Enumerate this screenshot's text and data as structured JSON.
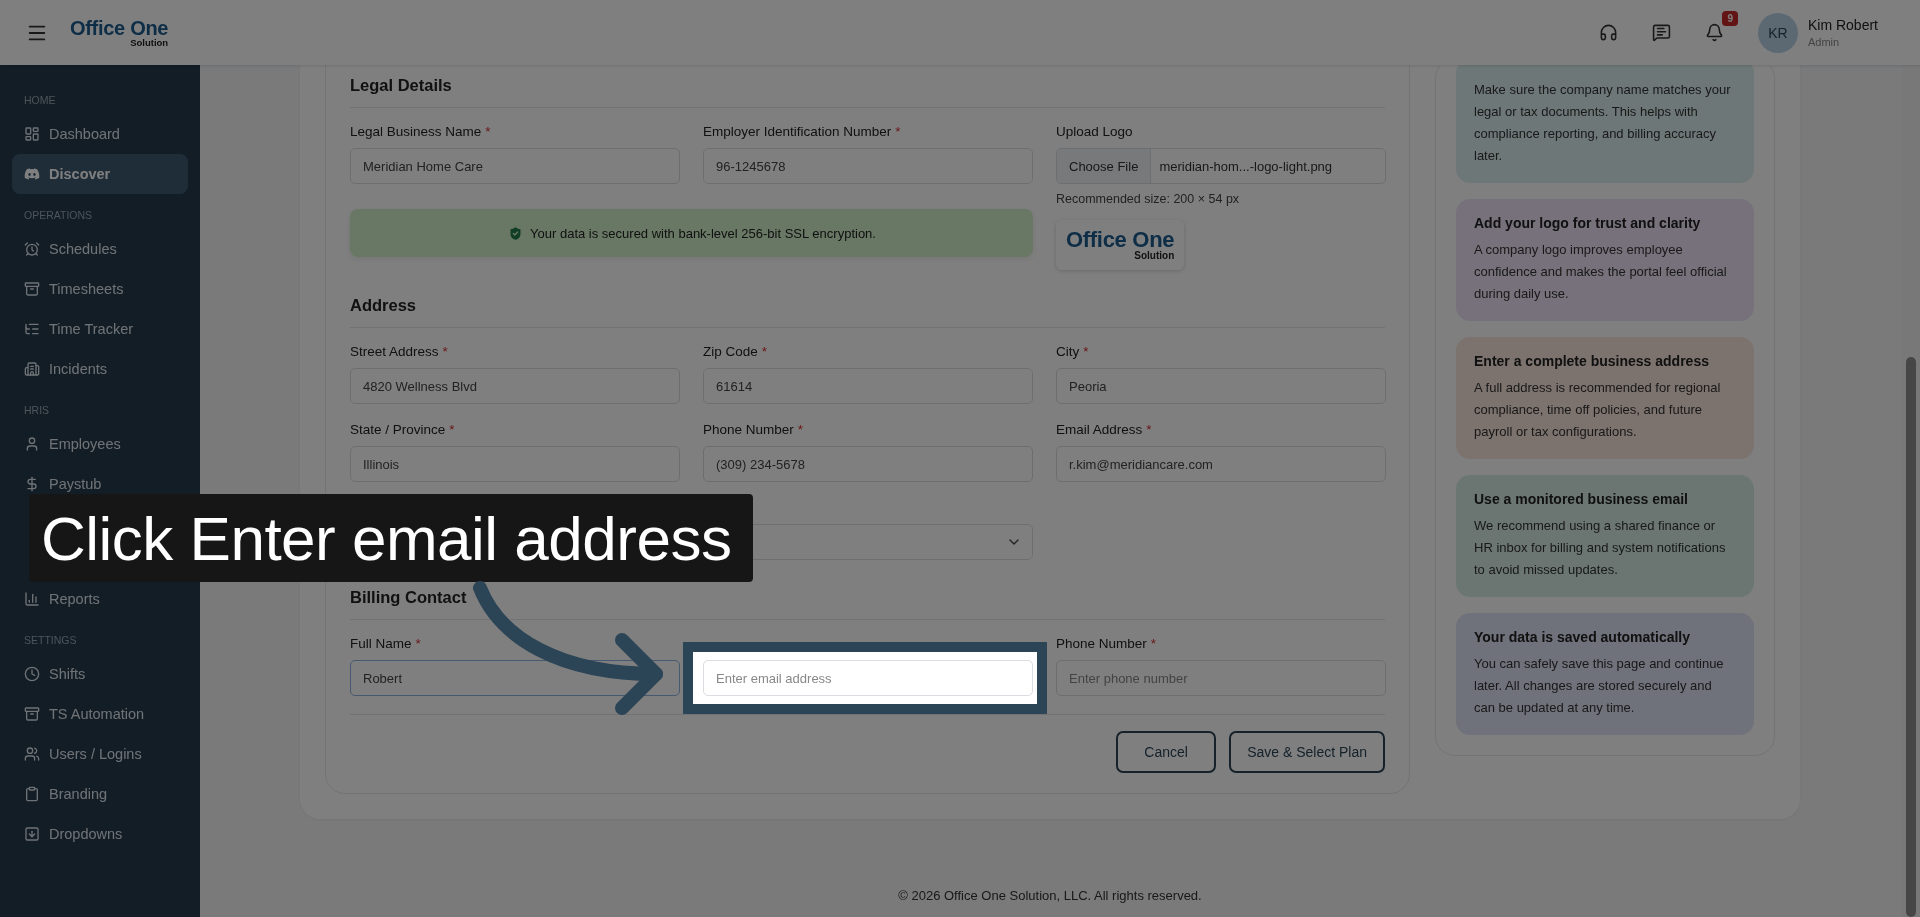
{
  "header": {
    "logo": {
      "name": "Office One",
      "tagline": "Solution"
    },
    "notifications_badge": "9",
    "user": {
      "initials": "KR",
      "name": "Kim Robert",
      "role": "Admin"
    }
  },
  "sidebar": {
    "sections": [
      {
        "label": "HOME",
        "items": [
          {
            "label": "Dashboard",
            "selected": false
          },
          {
            "label": "Discover",
            "selected": true
          }
        ]
      },
      {
        "label": "OPERATIONS",
        "items": [
          {
            "label": "Schedules",
            "selected": false
          },
          {
            "label": "Timesheets",
            "selected": false
          },
          {
            "label": "Time Tracker",
            "selected": false
          },
          {
            "label": "Incidents",
            "selected": false
          }
        ]
      },
      {
        "label": "HRIS",
        "items": [
          {
            "label": "Employees",
            "selected": false
          },
          {
            "label": "Paystub",
            "selected": false
          }
        ]
      },
      {
        "items": [
          {
            "label": "Reports",
            "selected": false
          }
        ]
      },
      {
        "label": "SETTINGS",
        "items": [
          {
            "label": "Shifts",
            "selected": false
          },
          {
            "label": "TS Automation",
            "selected": false
          },
          {
            "label": "Users / Logins",
            "selected": false
          },
          {
            "label": "Branding",
            "selected": false
          },
          {
            "label": "Dropdowns",
            "selected": false
          }
        ]
      }
    ]
  },
  "legal_details": {
    "title": "Legal Details",
    "fields": [
      {
        "label": "Legal Business Name",
        "mark": "*",
        "value": "Meridian Home Care"
      },
      {
        "label": "Employer Identification Number",
        "mark": "*",
        "value": "96-1245678"
      }
    ],
    "upload_logo": {
      "label": "Upload Logo",
      "button": "Choose File",
      "file_name": "meridian-hom...-logo-light.png",
      "hint": "Recommended size: 200 × 54 px",
      "preview": {
        "name": "Office One",
        "tagline": "Solution"
      }
    },
    "security_note": "Your data is secured with bank-level 256-bit SSL encryption."
  },
  "address": {
    "title": "Address",
    "fields": [
      {
        "kind": "text",
        "label": "Street Address",
        "mark": "*",
        "value": "4820 Wellness Blvd"
      },
      {
        "kind": "text",
        "label": "Zip Code",
        "mark": "*",
        "value": "61614"
      },
      {
        "kind": "text",
        "label": "City",
        "mark": "*",
        "value": "Peoria"
      },
      {
        "kind": "text",
        "label": "State / Province",
        "mark": "*",
        "value": "Illinois"
      },
      {
        "kind": "text",
        "label": "Phone Number",
        "mark": "*",
        "value": "(309) 234-5678"
      },
      {
        "kind": "text",
        "label": "Email Address",
        "mark": "*",
        "value": "r.kim@meridiancare.com"
      },
      {
        "kind": "blank"
      },
      {
        "kind": "select"
      }
    ]
  },
  "billing_contact": {
    "title": "Billing Contact",
    "fields": [
      {
        "label": "Full Name",
        "mark": "*",
        "value": "Robert",
        "focused": true
      },
      {
        "placeholder": "Enter email address",
        "focused": false
      },
      {
        "label": "Phone Number",
        "mark": "*",
        "placeholder": "Enter phone number",
        "focused": false
      }
    ]
  },
  "buttons": [
    "Cancel",
    "Save & Select Plan"
  ],
  "tips": [
    {
      "body": "Make sure the company name matches your legal or tax documents. This helps with compliance reporting, and billing accuracy later."
    },
    {
      "title": "Add your logo for trust and clarity",
      "body": "A company logo improves employee confidence and makes the portal feel official during daily use."
    },
    {
      "title": "Enter a complete business address",
      "body": "A full address is recommended for regional compliance, time off policies, and future payroll or tax configurations."
    },
    {
      "title": "Use a monitored business email",
      "body": "We recommend using a shared finance or HR inbox for billing and system notifications to avoid missed updates."
    },
    {
      "title": "Your data is saved automatically",
      "body": "You can safely save this page and continue later. All changes are stored securely and can be updated at any time."
    }
  ],
  "footer": "© 2026 Office One Solution, LLC. All rights reserved.",
  "guide": {
    "caption": "Click Enter email address"
  }
}
